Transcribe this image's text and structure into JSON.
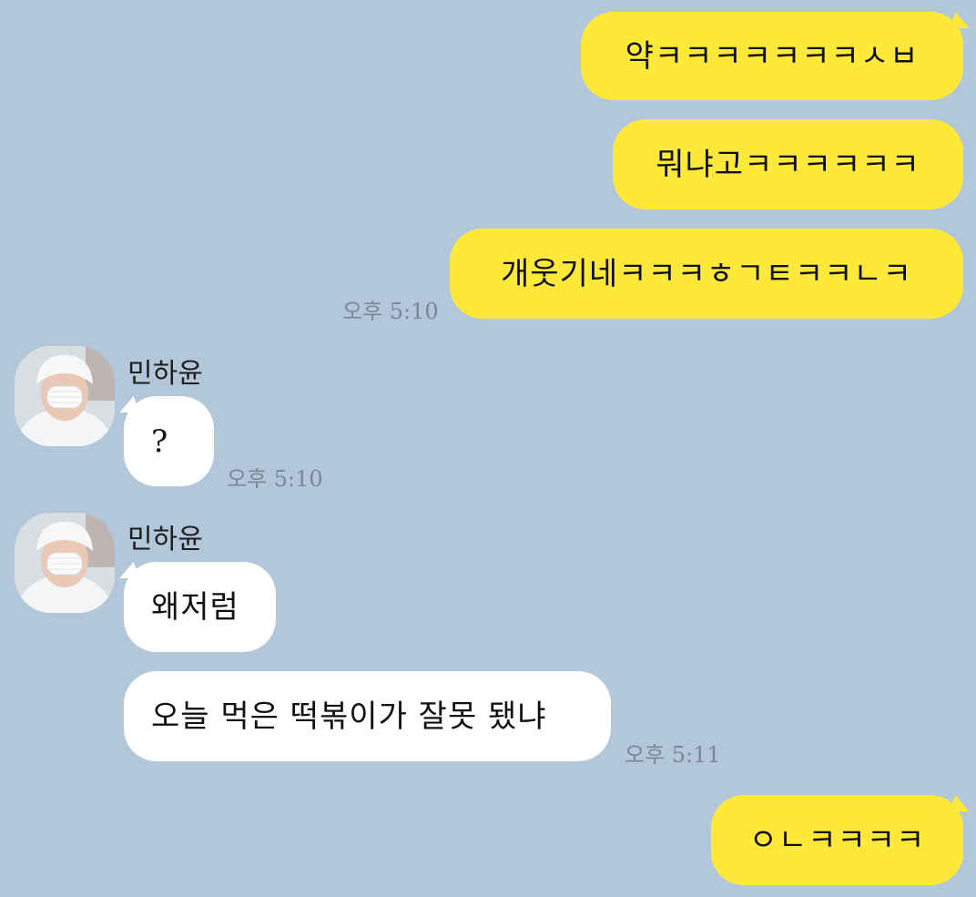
{
  "messages": {
    "m1": "약ㅋㅋㅋㅋㅋㅋㅋㅅㅂ",
    "m2": "뭐냐고ㅋㅋㅋㅋㅋㅋ",
    "m3": "개웃기네ㅋㅋㅋㅎㄱㅌㅋㅋㄴㅋ",
    "m3_time": "오후 5:10",
    "m4_sender": "민하윤",
    "m4": "?",
    "m4_time": "오후 5:10",
    "m5_sender": "민하윤",
    "m5": "왜저럼",
    "m6": "오늘 먹은 떡볶이가 잘못 됐냐",
    "m6_time": "오후 5:11",
    "m7": "ㅇㄴㅋㅋㅋㅋ"
  },
  "colors": {
    "background": "#b2c7da",
    "my_bubble": "#fee93b",
    "their_bubble": "#ffffff",
    "timestamp": "#7a8794"
  },
  "icons": {
    "avatar": "profile-photo-person-white-hat-mask"
  }
}
